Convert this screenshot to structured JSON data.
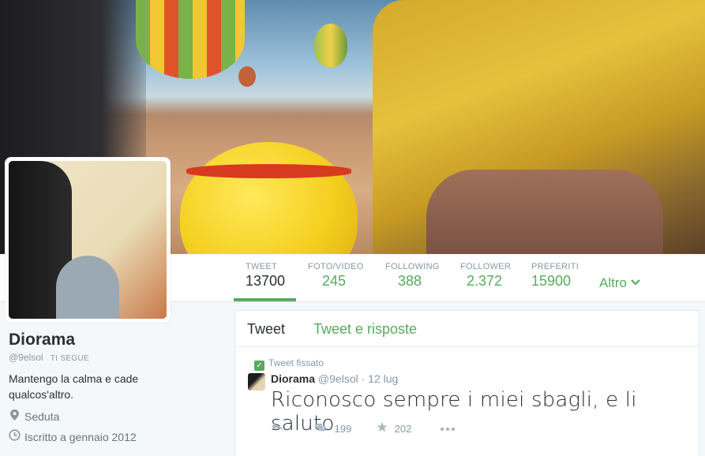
{
  "profile": {
    "name": "Diorama",
    "handle": "@9elsol",
    "follows_you": "TI SEGUE",
    "bio": "Mantengo la calma e cade qualcos'altro.",
    "location": "Seduta",
    "joined": "Iscritto a gennaio 2012"
  },
  "stats": [
    {
      "label": "TWEET",
      "value": "13700",
      "active": true
    },
    {
      "label": "FOTO/VIDEO",
      "value": "245"
    },
    {
      "label": "FOLLOWING",
      "value": "388"
    },
    {
      "label": "FOLLOWER",
      "value": "2.372"
    },
    {
      "label": "PREFERITI",
      "value": "15900"
    }
  ],
  "more_label": "Altro",
  "tabs": [
    "Tweet",
    "Tweet e risposte"
  ],
  "tweet": {
    "pinned_label": "Tweet fissato",
    "author": "Diorama",
    "handle": "@9elsol",
    "time": "· 12 lug",
    "text": "Riconosco sempre i miei sbagli, e li saluto.",
    "retweets": "199",
    "favorites": "202"
  },
  "colors": {
    "accent": "#55ac5d",
    "text": "#292f33",
    "muted": "#8899a6"
  },
  "icons": [
    "location-pin-icon",
    "clock-icon",
    "reply-icon",
    "retweet-icon",
    "star-icon",
    "more-icon",
    "pin-icon",
    "chevron-down-icon"
  ]
}
